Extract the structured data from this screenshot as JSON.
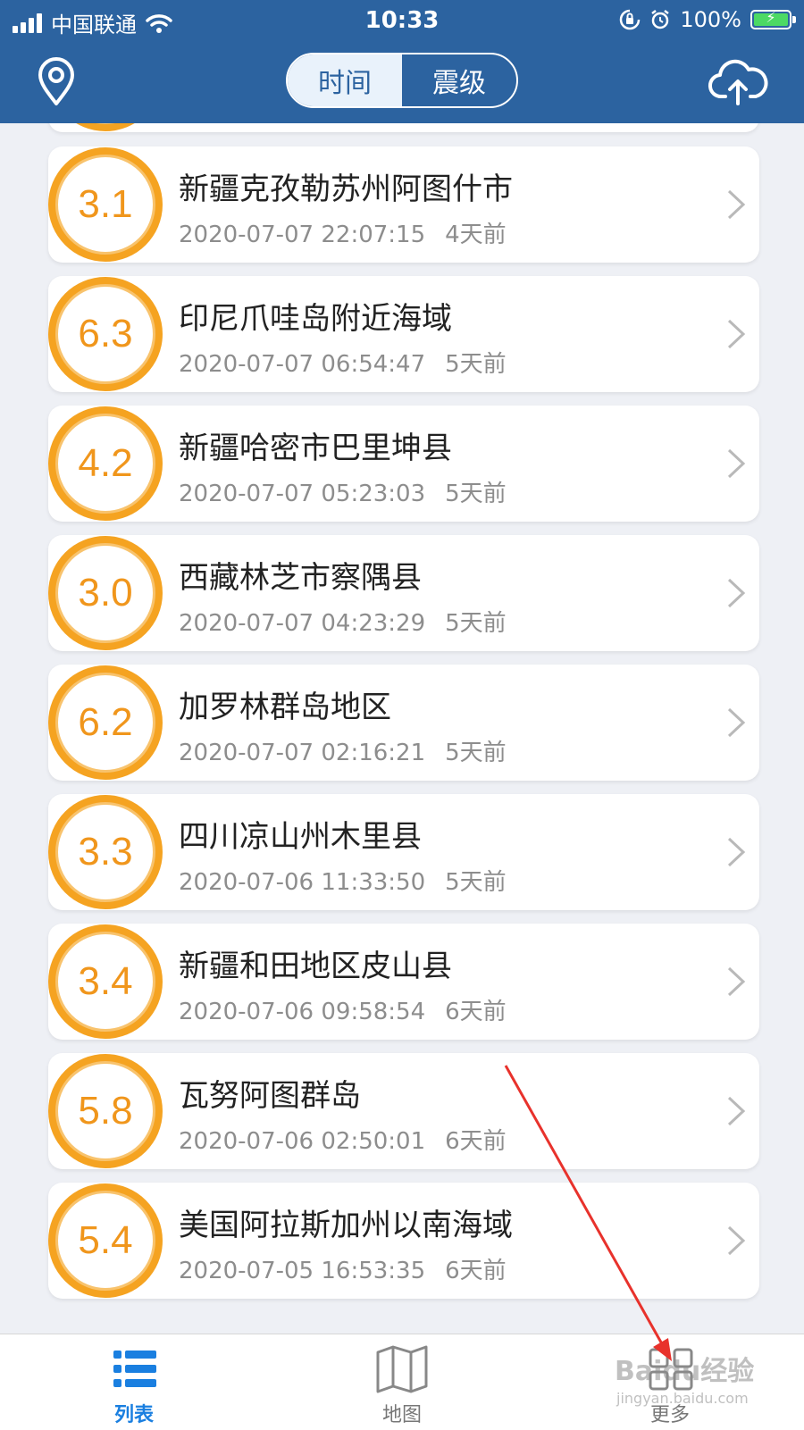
{
  "status_bar": {
    "carrier": "中国联通",
    "time": "10:33",
    "battery": "100%"
  },
  "header": {
    "segments": [
      {
        "label": "时间",
        "active": true
      },
      {
        "label": "震级",
        "active": false
      }
    ]
  },
  "quakes": [
    {
      "magnitude": "3.1",
      "location": "新疆克孜勒苏州阿图什市",
      "datetime": "2020-07-07 22:07:15",
      "ago": "4天前"
    },
    {
      "magnitude": "6.3",
      "location": "印尼爪哇岛附近海域",
      "datetime": "2020-07-07 06:54:47",
      "ago": "5天前"
    },
    {
      "magnitude": "4.2",
      "location": "新疆哈密市巴里坤县",
      "datetime": "2020-07-07 05:23:03",
      "ago": "5天前"
    },
    {
      "magnitude": "3.0",
      "location": "西藏林芝市察隅县",
      "datetime": "2020-07-07 04:23:29",
      "ago": "5天前"
    },
    {
      "magnitude": "6.2",
      "location": "加罗林群岛地区",
      "datetime": "2020-07-07 02:16:21",
      "ago": "5天前"
    },
    {
      "magnitude": "3.3",
      "location": "四川凉山州木里县",
      "datetime": "2020-07-06 11:33:50",
      "ago": "5天前"
    },
    {
      "magnitude": "3.4",
      "location": "新疆和田地区皮山县",
      "datetime": "2020-07-06 09:58:54",
      "ago": "6天前"
    },
    {
      "magnitude": "5.8",
      "location": "瓦努阿图群岛",
      "datetime": "2020-07-06 02:50:01",
      "ago": "6天前"
    },
    {
      "magnitude": "5.4",
      "location": "美国阿拉斯加州以南海域",
      "datetime": "2020-07-05 16:53:35",
      "ago": "6天前"
    }
  ],
  "tabbar": {
    "tabs": [
      {
        "label": "列表",
        "icon": "list-icon",
        "active": true
      },
      {
        "label": "地图",
        "icon": "map-icon",
        "active": false
      },
      {
        "label": "更多",
        "icon": "grid-icon",
        "active": false
      }
    ]
  },
  "watermark": {
    "text": "Baidu经验",
    "url": "jingyan.baidu.com"
  },
  "colors": {
    "header_bg": "#2c63a0",
    "badge_orange": "#f5a321",
    "active_tab": "#1a7fe0",
    "annotation_arrow": "#e8322c"
  }
}
